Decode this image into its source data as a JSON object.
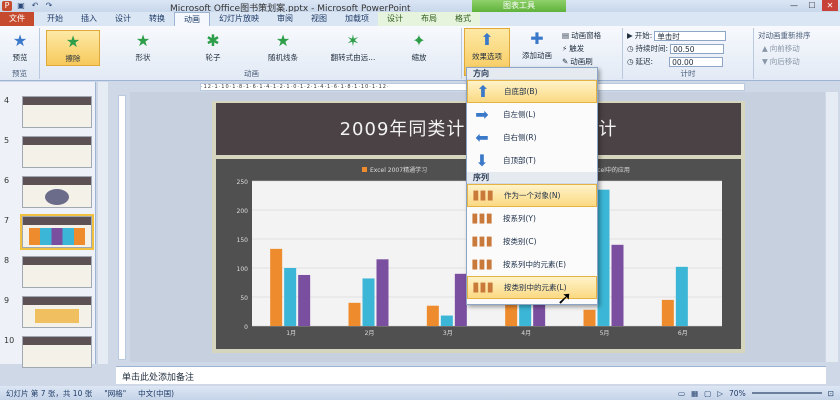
{
  "title": "Microsoft Office图书策划案.pptx - Microsoft PowerPoint",
  "context_tab": "图表工具",
  "tabs": [
    "文件",
    "开始",
    "插入",
    "设计",
    "转换",
    "动画",
    "幻灯片放映",
    "审阅",
    "视图",
    "加载项",
    "设计",
    "布局",
    "格式"
  ],
  "ribbon": {
    "preview": "预览",
    "preview_group": "预览",
    "animations": [
      "擦除",
      "形状",
      "轮子",
      "随机线条",
      "翻转式由远...",
      "缩放"
    ],
    "animation_group": "动画",
    "effect_options": "效果选项",
    "add_animation": "添加动画",
    "anim_pane": "动画窗格",
    "trigger": "触发",
    "anim_painter": "动画刷",
    "start_label": "开始:",
    "start_value": "单击时",
    "duration_label": "持续时间:",
    "duration_value": "00.50",
    "delay_label": "延迟:",
    "delay_value": "00.00",
    "timing_group": "计时",
    "reorder": "对动画重新排序",
    "move_earlier": "向前移动",
    "move_later": "向后移动"
  },
  "slides": [
    {
      "num": "4"
    },
    {
      "num": "5"
    },
    {
      "num": "6"
    },
    {
      "num": "7"
    },
    {
      "num": "8"
    },
    {
      "num": "9"
    },
    {
      "num": "10"
    }
  ],
  "ruler_text": "·12·1·10·1·8·1·6·1·4·1·2·1·0·1·2·1·4·1·6·1·8·1·10·1·12·",
  "slide_title": "2009年同类计算机图书销售统计",
  "chart_data": {
    "type": "bar",
    "categories": [
      "1月",
      "2月",
      "3月",
      "4月",
      "5月",
      "6月"
    ],
    "series": [
      {
        "name": "Excel 2007精通学习",
        "values": [
          133,
          40,
          35,
          50,
          28,
          45
        ]
      },
      {
        "name": "Excel函数应用",
        "values": [
          100,
          82,
          18,
          75,
          235,
          102
        ]
      },
      {
        "name": "Excel中的应用",
        "values": [
          88,
          115,
          90,
          90,
          140,
          0
        ]
      }
    ],
    "yticks": [
      "0",
      "50",
      "100",
      "150",
      "200",
      "250"
    ],
    "ylim": [
      0,
      250
    ],
    "colors": [
      "#ee8c2d",
      "#3cb6d6",
      "#7b4fa0"
    ]
  },
  "dropdown": {
    "direction_header": "方向",
    "direction_items": [
      "自底部(B)",
      "自左侧(L)",
      "自右侧(R)",
      "自顶部(T)"
    ],
    "sequence_header": "序列",
    "sequence_items": [
      "作为一个对象(N)",
      "按系列(Y)",
      "按类别(C)",
      "按系列中的元素(E)",
      "按类别中的元素(L)"
    ]
  },
  "notes": "单击此处添加备注",
  "status": {
    "slide": "幻灯片 第 7 张，共 10 张",
    "theme": "\"网格\"",
    "lang": "中文(中国)",
    "zoom": "70%"
  }
}
